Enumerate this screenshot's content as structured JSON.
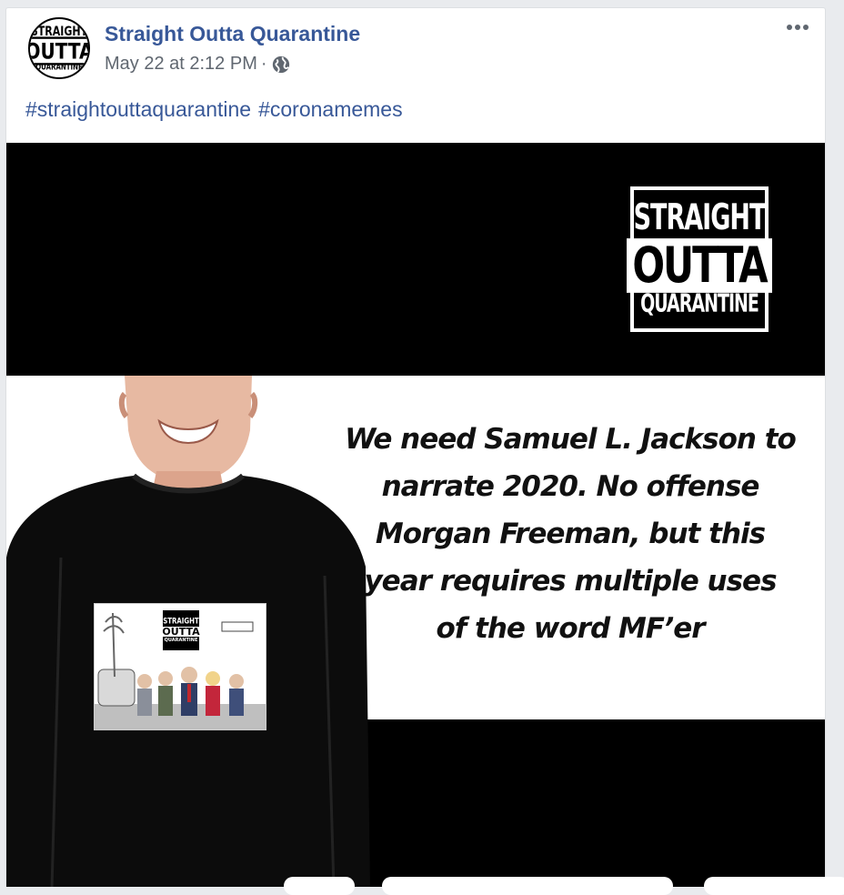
{
  "post": {
    "page_name": "Straight Outta Quarantine",
    "timestamp": "May 22 at 2:12 PM",
    "separator": "·",
    "privacy_icon": "globe-icon",
    "more_icon": "more-options-icon",
    "hashtags": [
      "#straightouttaquarantine",
      "#coronamemes"
    ]
  },
  "avatar": {
    "line1": "STRAIGHT",
    "line2": "OUTTA",
    "line3": "QUARANTINE"
  },
  "image": {
    "logo": {
      "line1": "STRAIGHT",
      "line2": "OUTTA",
      "line3": "QUARANTINE"
    },
    "quote_lines": [
      "We need Samuel L. Jackson to",
      "narrate 2020. No offense",
      "Morgan Freeman, but this",
      "year requires multiple uses",
      "of the word MF’er"
    ],
    "shirt_print": {
      "line1": "STRAIGHT",
      "line2": "OUTTA",
      "line3": "QUARANTINE"
    }
  },
  "colors": {
    "link_blue": "#385898",
    "meta_gray": "#606770",
    "background": "#e9ebee"
  }
}
